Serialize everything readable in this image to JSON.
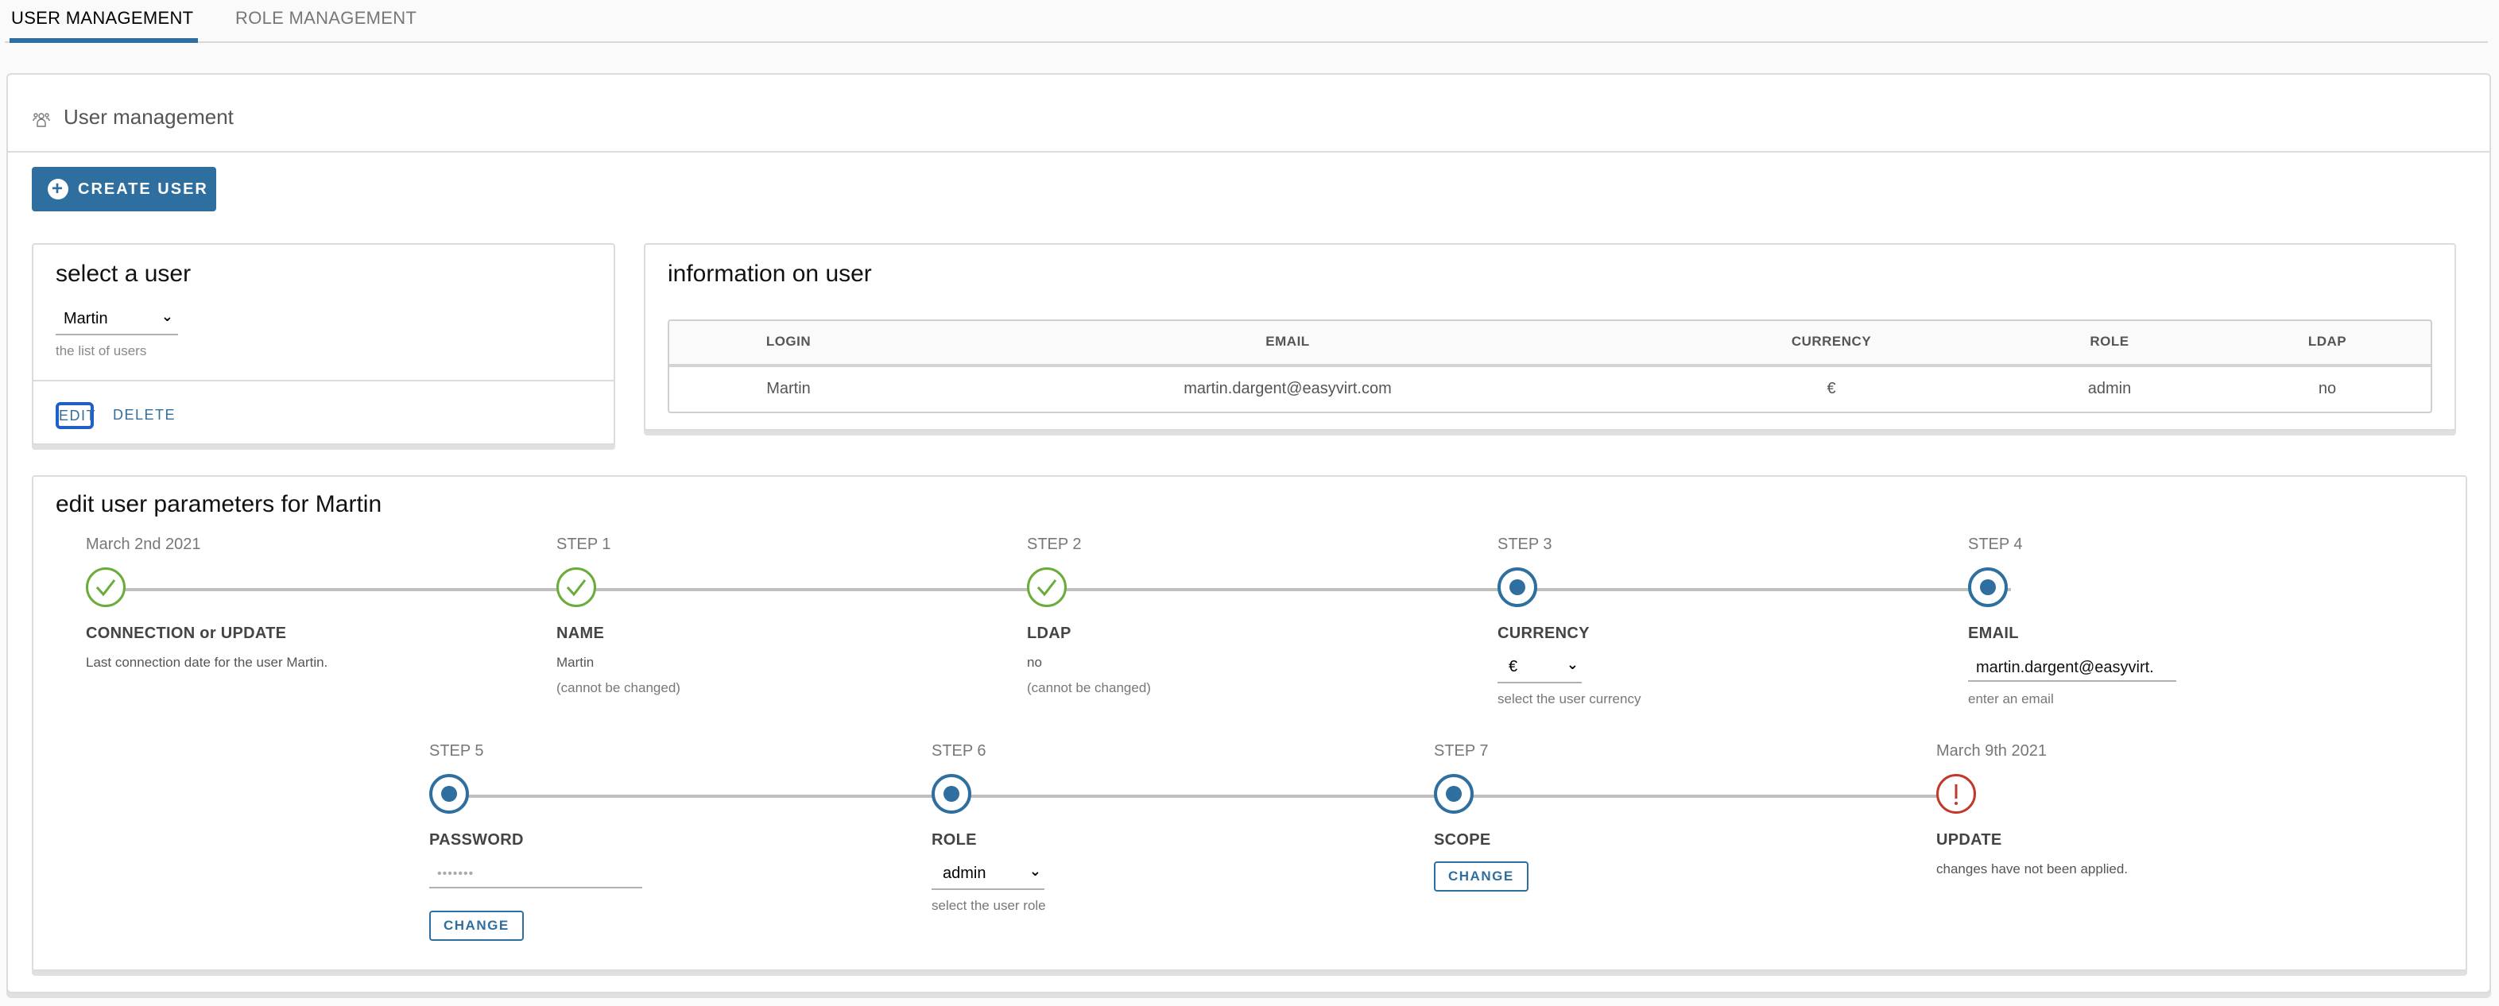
{
  "tabs": [
    {
      "label": "USER MANAGEMENT",
      "active": true
    },
    {
      "label": "ROLE MANAGEMENT",
      "active": false
    }
  ],
  "main": {
    "title": "User management",
    "title_icon": "users-group-icon",
    "create_button": "CREATE USER"
  },
  "select_user": {
    "title": "select a user",
    "selected": "Martin",
    "helper": "the list of users",
    "edit_label": "EDIT",
    "delete_label": "DELETE"
  },
  "info": {
    "title": "information on user",
    "columns": [
      "LOGIN",
      "EMAIL",
      "CURRENCY",
      "ROLE",
      "LDAP"
    ],
    "rows": [
      [
        "Martin",
        "martin.dargent@easyvirt.com",
        "€",
        "admin",
        "no"
      ]
    ]
  },
  "edit": {
    "title": "edit user parameters for Martin",
    "steps": [
      {
        "top": "March 2nd 2021",
        "label": "CONNECTION or UPDATE",
        "desc": "Last connection date for the user Martin.",
        "state": "done"
      },
      {
        "top": "STEP 1",
        "label": "NAME",
        "desc": "Martin",
        "sub": "(cannot be changed)",
        "state": "done"
      },
      {
        "top": "STEP 2",
        "label": "LDAP",
        "desc": "no",
        "sub": "(cannot be changed)",
        "state": "done"
      },
      {
        "top": "STEP 3",
        "label": "CURRENCY",
        "value": "€",
        "helper": "select the user currency",
        "state": "current"
      },
      {
        "top": "STEP 4",
        "label": "EMAIL",
        "value": "martin.dargent@easyvirt.",
        "helper": "enter an email",
        "state": "current"
      },
      {
        "top": "STEP 5",
        "label": "PASSWORD",
        "value": "•••••••",
        "button": "CHANGE",
        "state": "current"
      },
      {
        "top": "STEP 6",
        "label": "ROLE",
        "value": "admin",
        "helper": "select the user role",
        "state": "current"
      },
      {
        "top": "STEP 7",
        "label": "SCOPE",
        "button": "CHANGE",
        "state": "current"
      },
      {
        "top": "March 9th 2021",
        "label": "UPDATE",
        "desc": "changes have not been applied.",
        "state": "error"
      }
    ]
  },
  "colors": {
    "accent": "#2f6f9f",
    "success": "#6aab3a",
    "error": "#c0392b",
    "focus": "#1f5fc8"
  }
}
